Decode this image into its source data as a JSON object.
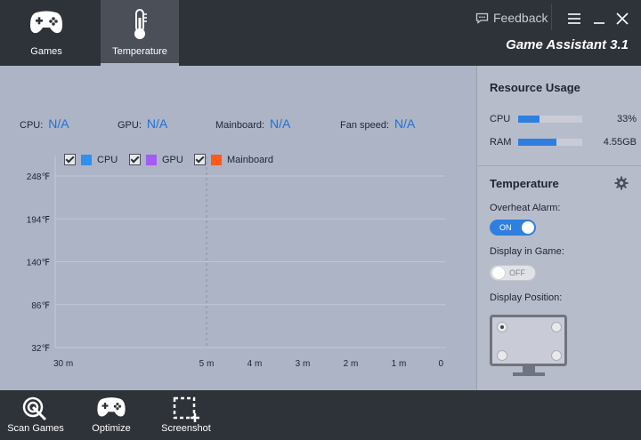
{
  "header": {
    "tabs": [
      {
        "label": "Games",
        "icon": "gamepad-icon"
      },
      {
        "label": "Temperature",
        "icon": "thermometer-icon"
      }
    ],
    "feedback_label": "Feedback",
    "app_title": "Game Assistant 3.1"
  },
  "readouts": {
    "cpu_label": "CPU:",
    "cpu_value": "N/A",
    "gpu_label": "GPU:",
    "gpu_value": "N/A",
    "mainboard_label": "Mainboard:",
    "mainboard_value": "N/A",
    "fan_label": "Fan speed:",
    "fan_value": "N/A"
  },
  "legend": [
    {
      "name": "CPU",
      "color": "#2f8ff0"
    },
    {
      "name": "GPU",
      "color": "#a35bf5"
    },
    {
      "name": "Mainboard",
      "color": "#ff5a1a"
    }
  ],
  "chart_data": {
    "type": "line",
    "yticks": [
      "248℉",
      "194℉",
      "140℉",
      "86℉",
      "32℉"
    ],
    "xticks": [
      "30 m",
      "5 m",
      "4 m",
      "3 m",
      "2 m",
      "1 m",
      "0"
    ],
    "ylim": [
      32,
      248
    ],
    "series": [
      {
        "name": "CPU",
        "values": []
      },
      {
        "name": "GPU",
        "values": []
      },
      {
        "name": "Mainboard",
        "values": []
      }
    ],
    "grid": true
  },
  "resource_usage": {
    "title": "Resource Usage",
    "cpu": {
      "label": "CPU",
      "percent": 33,
      "value_text": "33%"
    },
    "ram": {
      "label": "RAM",
      "fraction": 0.6,
      "value_text": "4.55GB"
    }
  },
  "temperature_panel": {
    "title": "Temperature",
    "overheat_label": "Overheat Alarm:",
    "overheat_state": "ON",
    "display_in_game_label": "Display in Game:",
    "display_in_game_state": "OFF",
    "display_position_label": "Display Position:"
  },
  "bottom": {
    "scan_games": "Scan Games",
    "optimize": "Optimize",
    "screenshot": "Screenshot"
  },
  "colors": {
    "accent": "#2f7fe0",
    "header_bg": "#2e3239",
    "main_bg": "#adb4c5"
  }
}
